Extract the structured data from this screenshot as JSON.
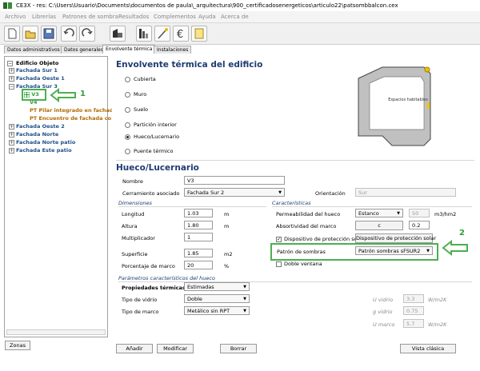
{
  "window": {
    "title": "CE3X - res: C:\\Users\\Usuario\\Documents\\documentos de paula\\_arquitectura\\900_certificadosenergeticos\\articulo22\\patsombbalcon.cex"
  },
  "menu": [
    "Archivo",
    "Librerías",
    "Patrones de sombra",
    "Resultados",
    "Complementos",
    "Ayuda",
    "Acerca de"
  ],
  "tabs": [
    "Datos administrativos",
    "Datos generales",
    "Envolvente térmica",
    "Instalaciones"
  ],
  "tree": {
    "root": "Edificio Objeto",
    "items": [
      "Fachada Sur 1",
      "Fachada Oeste 1",
      "Fachada Sur 3",
      "V3",
      "V4",
      "PT Pilar integrado en fachada",
      "PT Encuentro de fachada co",
      "Fachada Oeste 2",
      "Fachada Norte",
      "Fachada Norte patio",
      "Fachada Este patio"
    ],
    "zonas_button": "Zonas"
  },
  "header": {
    "title": "Envolvente térmica del edificio"
  },
  "radios": [
    "Cubierta",
    "Muro",
    "Suelo",
    "Partición interior",
    "Hueco/Lucernario",
    "Puente térmico"
  ],
  "diagram": {
    "label": "Espacios habitables"
  },
  "hueco": {
    "title": "Hueco/Lucernario",
    "nombre_label": "Nombre",
    "nombre_value": "V3",
    "cerramiento_label": "Cerramiento asociado",
    "cerramiento_value": "Fachada Sur 2",
    "orientacion_label": "Orientación",
    "orientacion_value": "Sur"
  },
  "dimensiones": {
    "title": "Dimensiones",
    "longitud_label": "Longitud",
    "longitud_value": "1.03",
    "longitud_unit": "m",
    "altura_label": "Altura",
    "altura_value": "1.80",
    "altura_unit": "m",
    "multiplicador_label": "Multiplicador",
    "multiplicador_value": "1",
    "superficie_label": "Superficie",
    "superficie_value": "1.85",
    "superficie_unit": "m2",
    "marco_label": "Porcentaje de marco",
    "marco_value": "20",
    "marco_unit": "%"
  },
  "caracteristicas": {
    "title": "Características",
    "permeabilidad_label": "Permeabilidad del hueco",
    "permeabilidad_select": "Estanco",
    "permeabilidad_value": "50",
    "permeabilidad_unit": "m3/hm2",
    "absortividad_label": "Absortividad del marco",
    "absortividad_btn": "c",
    "absortividad_value": "0.2",
    "dispositivo_label": "Dispositivo de protección solar",
    "dispositivo_btn": "Dispositivo de protección solar",
    "patron_label": "Patrón de sombras",
    "patron_value": "Patrón sombras sFSUR2",
    "doble_label": "Doble ventana"
  },
  "parametros": {
    "title": "Parámetros característicos del hueco",
    "prop_label": "Propiedades térmicas",
    "prop_value": "Estimadas",
    "vidrio_label": "Tipo de vidrio",
    "vidrio_value": "Doble",
    "marco_label": "Tipo de marco",
    "marco_value": "Metálico sin RPT",
    "u_vidrio_label": "U vidrio",
    "u_vidrio_value": "3.3",
    "u_vidrio_unit": "W/m2K",
    "g_vidrio_label": "g vidrio",
    "g_vidrio_value": "0.75",
    "u_marco_label": "U marco",
    "u_marco_value": "5.7",
    "u_marco_unit": "W/m2K"
  },
  "buttons": {
    "anadir": "Añadir",
    "modificar": "Modificar",
    "borrar": "Borrar",
    "vista": "Vista clásica"
  },
  "annotations": {
    "one": "1",
    "two": "2"
  },
  "colors": {
    "title_blue": "#1e3b72",
    "tree_blue": "#1f4f8a",
    "tree_orange": "#b36b00",
    "tree_green": "#2e9e3a",
    "highlight_green": "#4caf50"
  }
}
